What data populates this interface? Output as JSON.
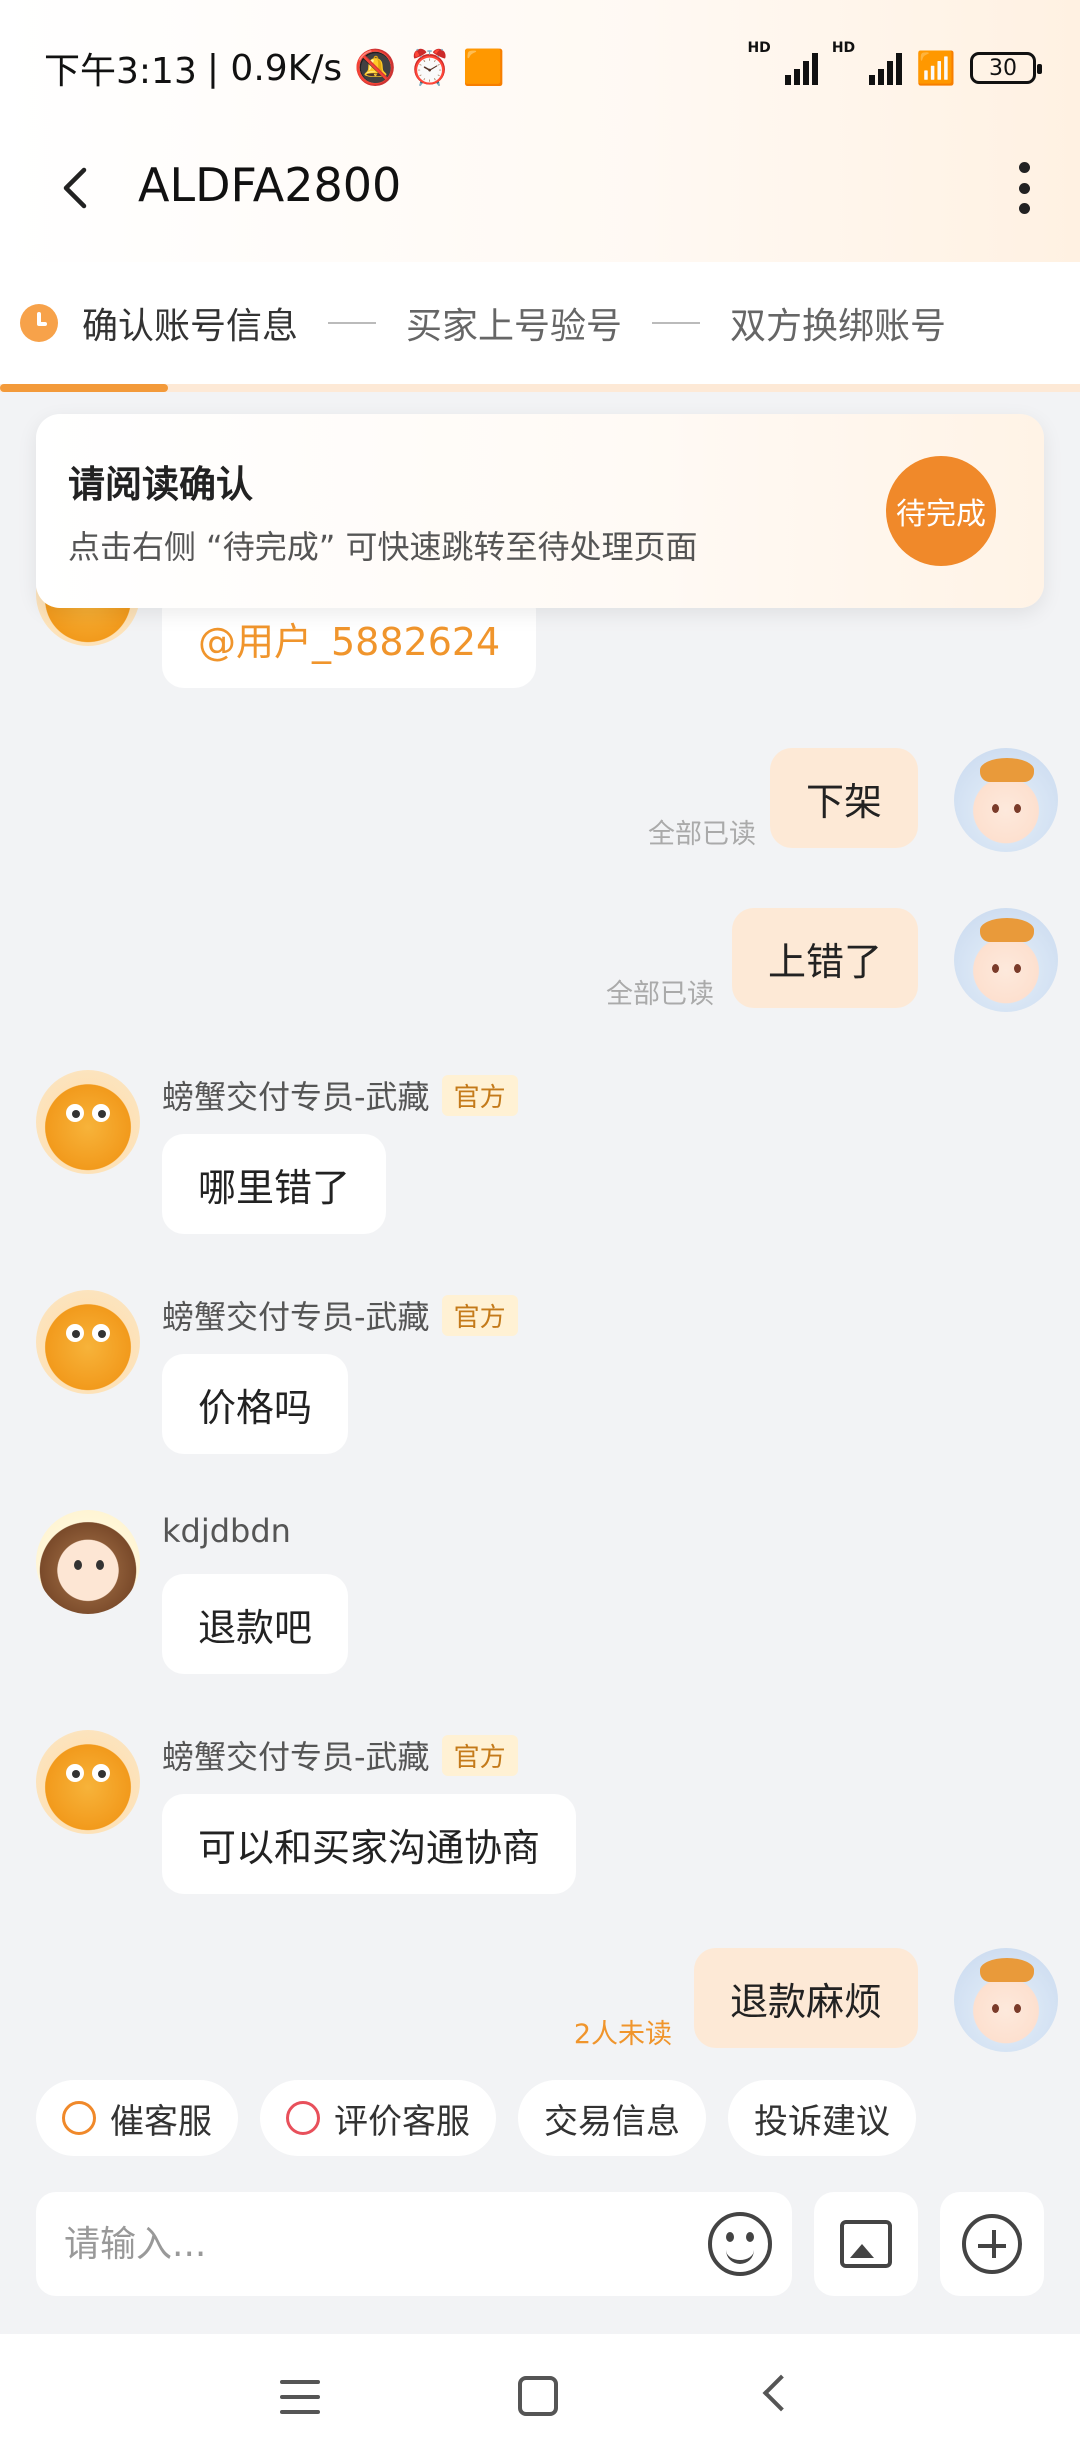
{
  "status_bar": {
    "time": "下午3:13",
    "speed": "| 0.9K/s",
    "hd1": "HD",
    "hd2": "HD",
    "battery": "30"
  },
  "header": {
    "title": "ALDFA2800"
  },
  "steps": {
    "items": [
      "确认账号信息",
      "买家上号验号",
      "双方换绑账号"
    ]
  },
  "notice": {
    "title": "请阅读确认",
    "description": "点击右侧 “待完成” 可快速跳转至待处理页面",
    "pending_button": "待完成"
  },
  "messages": {
    "mention": "@用户_5882624",
    "m1": {
      "text": "下架",
      "status": "全部已读"
    },
    "m2": {
      "text": "上错了",
      "status": "全部已读"
    },
    "m3": {
      "sender": "螃蟹交付专员-武藏",
      "badge": "官方",
      "text": "哪里错了"
    },
    "m4": {
      "sender": "螃蟹交付专员-武藏",
      "badge": "官方",
      "text": "价格吗"
    },
    "m5": {
      "sender": "kdjdbdn",
      "text": "退款吧"
    },
    "m6": {
      "sender": "螃蟹交付专员-武藏",
      "badge": "官方",
      "text": "可以和买家沟通协商"
    },
    "m7": {
      "text": "退款麻烦",
      "status": "2人未读"
    }
  },
  "tools": {
    "chips": [
      "催客服",
      "评价客服",
      "交易信息",
      "投诉建议"
    ],
    "input_placeholder": "请输入..."
  },
  "colors": {
    "accent": "#f0892a",
    "bubble_self": "#fde9d6",
    "background": "#f2f3f5"
  }
}
